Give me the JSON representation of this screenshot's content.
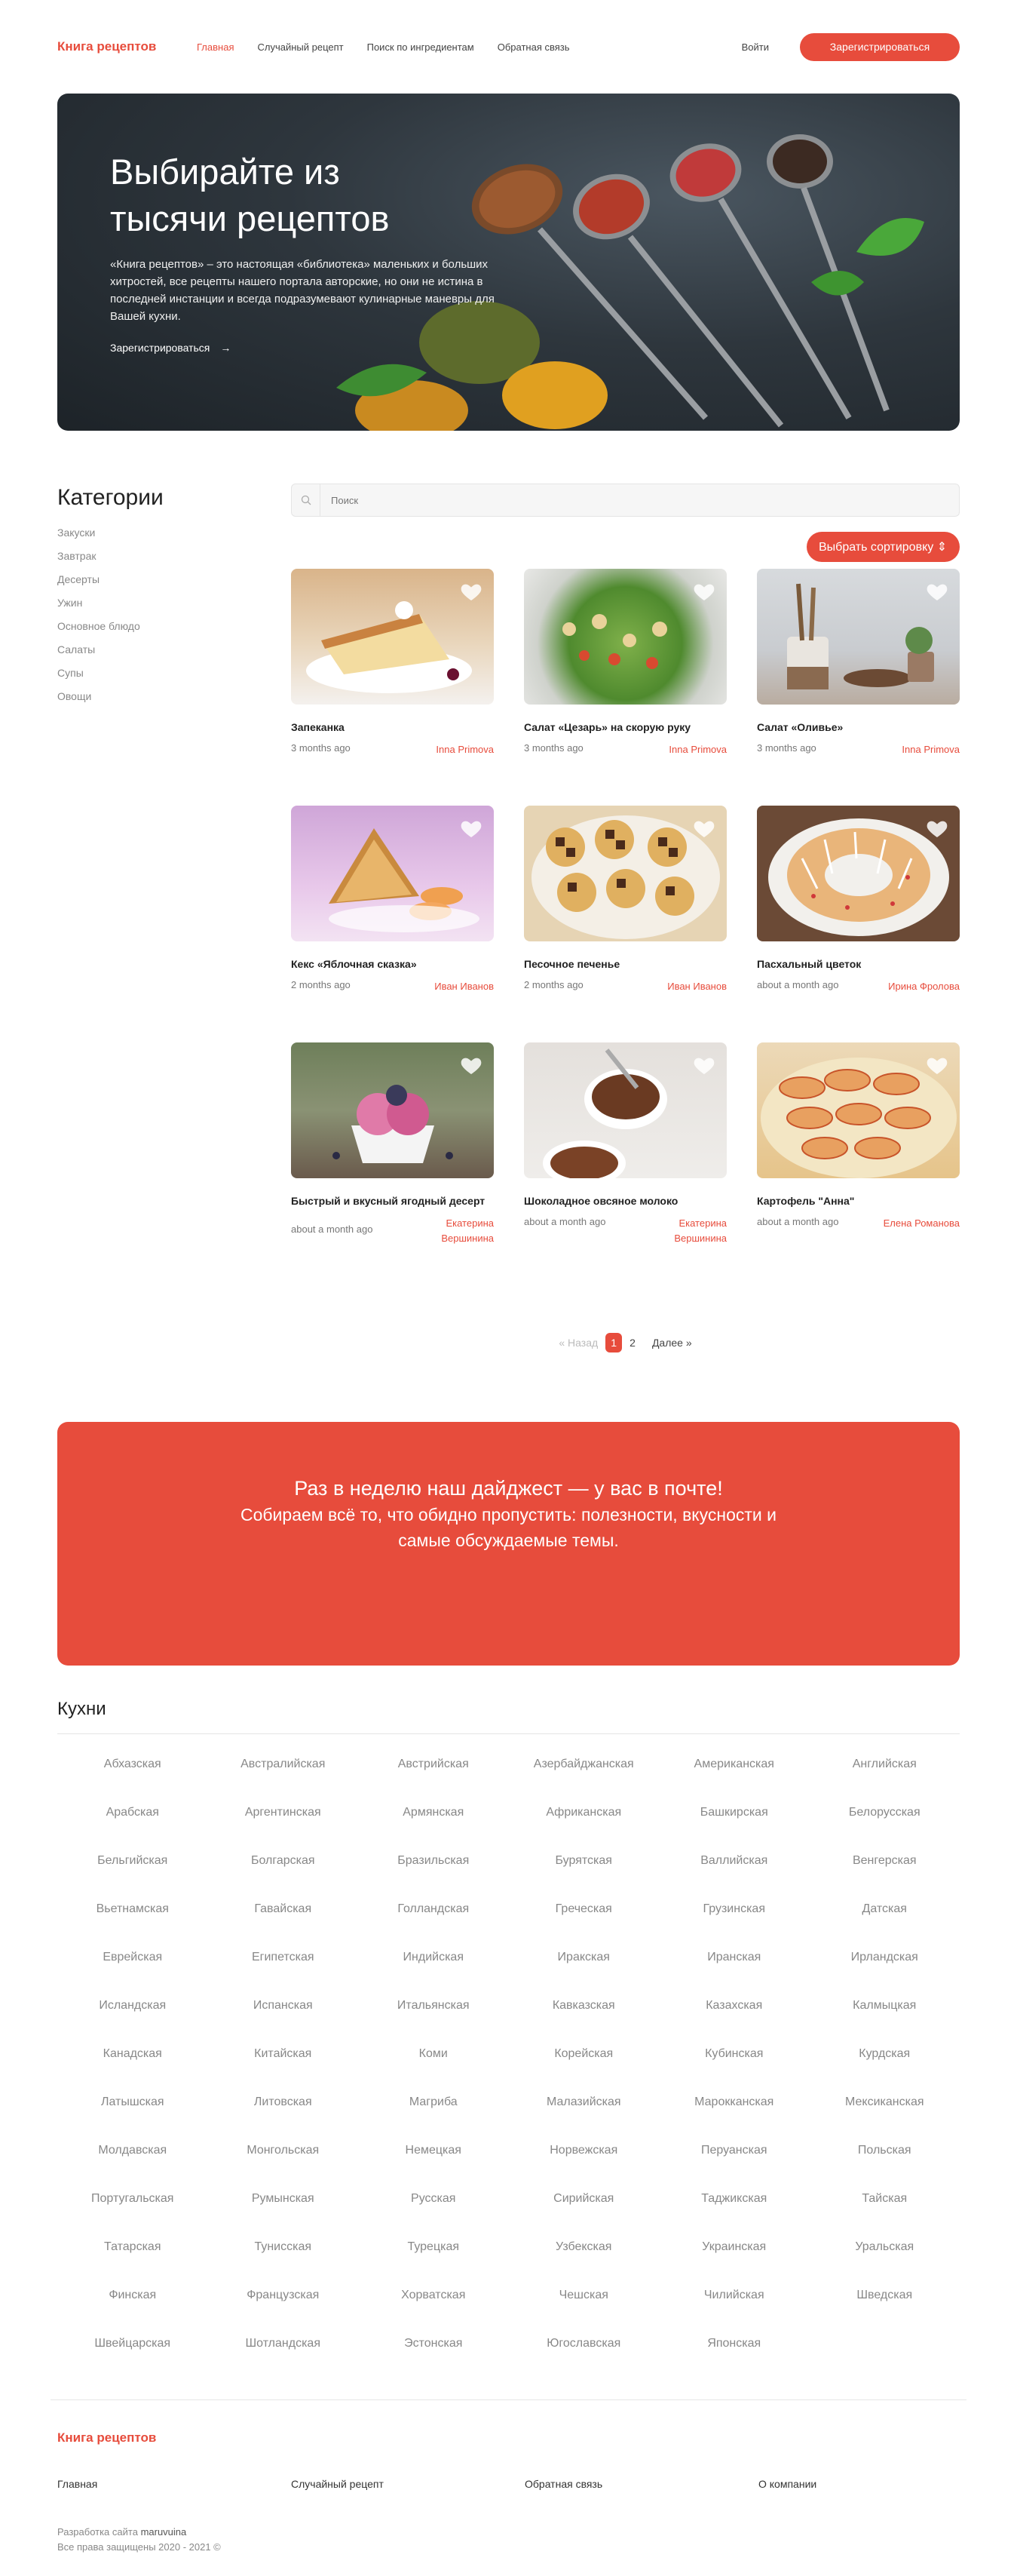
{
  "header": {
    "logo": "Книга рецептов",
    "nav": [
      "Главная",
      "Случайный рецепт",
      "Поиск по ингредиентам",
      "Обратная связь"
    ],
    "login": "Войти",
    "register": "Зарегистрироваться"
  },
  "hero": {
    "title_line1": "Выбирайте из",
    "title_line2": "тысячи рецептов",
    "description": "«Книга рецептов» – это настоящая «библиотека» маленьких и больших хитростей, все рецепты нашего портала авторские, но они не истина в последней инстанции и всегда подразумевают кулинарные маневры для Вашей кухни.",
    "cta": "Зарегистрироваться",
    "cta_arrow": "→"
  },
  "sidebar": {
    "title": "Категории",
    "items": [
      "Закуски",
      "Завтрак",
      "Десерты",
      "Ужин",
      "Основное блюдо",
      "Салаты",
      "Супы",
      "Овощи"
    ]
  },
  "search": {
    "placeholder": "Поиск"
  },
  "sort_button": "Выбрать сортировку ⇕",
  "recipes": [
    {
      "title": "Запеканка",
      "date": "3 months ago",
      "author": "Inna Primova"
    },
    {
      "title": "Салат «Цезарь» на скорую руку",
      "date": "3 months ago",
      "author": "Inna Primova"
    },
    {
      "title": "Салат «Оливье»",
      "date": "3 months ago",
      "author": "Inna Primova"
    },
    {
      "title": "Кекс «Яблочная сказка»",
      "date": "2 months ago",
      "author": "Иван Иванов"
    },
    {
      "title": "Песочное печенье",
      "date": "2 months ago",
      "author": "Иван Иванов"
    },
    {
      "title": "Пасхальный цветок",
      "date": "about a month ago",
      "author": "Ирина Фролова"
    },
    {
      "title": "Быстрый и вкусный ягодный десерт",
      "date": "about a month ago",
      "author": "Екатерина Вершинина"
    },
    {
      "title": "Шоколадное овсяное молоко",
      "date": "about a month ago",
      "author": "Екатерина Вершинина"
    },
    {
      "title": "Картофель \"Анна\"",
      "date": "about a month ago",
      "author": "Елена Романова"
    }
  ],
  "pagination": {
    "prev": "« Назад",
    "pages": [
      "1",
      "2"
    ],
    "next": "Далее »"
  },
  "digest": {
    "headline": "Раз в неделю наш дайджест — у вас в почте!",
    "text": "Собираем всё то, что обидно пропустить: полезности, вкусности и самые обсуждаемые темы."
  },
  "cuisines": {
    "title": "Кухни",
    "items": [
      "Абхазская",
      "Австралийская",
      "Австрийская",
      "Азербайджанская",
      "Американская",
      "Английская",
      "Арабская",
      "Аргентинская",
      "Армянская",
      "Африканская",
      "Башкирская",
      "Белорусская",
      "Бельгийская",
      "Болгарская",
      "Бразильская",
      "Бурятская",
      "Валлийская",
      "Венгерская",
      "Вьетнамская",
      "Гавайская",
      "Голландская",
      "Греческая",
      "Грузинская",
      "Датская",
      "Еврейская",
      "Египетская",
      "Индийская",
      "Иракская",
      "Иранская",
      "Ирландская",
      "Исландская",
      "Испанская",
      "Итальянская",
      "Кавказская",
      "Казахская",
      "Калмыцкая",
      "Канадская",
      "Китайская",
      "Коми",
      "Корейская",
      "Кубинская",
      "Курдская",
      "Латышская",
      "Литовская",
      "Магриба",
      "Малазийская",
      "Марокканская",
      "Мексиканская",
      "Молдавская",
      "Монгольская",
      "Немецкая",
      "Норвежская",
      "Перуанская",
      "Польская",
      "Португальская",
      "Румынская",
      "Русская",
      "Сирийская",
      "Таджикская",
      "Тайская",
      "Татарская",
      "Тунисская",
      "Турецкая",
      "Узбекская",
      "Украинская",
      "Уральская",
      "Финская",
      "Французская",
      "Хорватская",
      "Чешская",
      "Чилийская",
      "Шведская",
      "Швейцарская",
      "Шотландская",
      "Эстонская",
      "Югославская",
      "Японская"
    ]
  },
  "footer": {
    "logo": "Книга рецептов",
    "links": [
      "Главная",
      "Случайный рецепт",
      "Обратная связь",
      "О компании"
    ],
    "dev_label": "Разработка сайта",
    "dev_name": "maruvuina",
    "copyright": "Все права защищены 2020 - 2021 ©"
  },
  "colors": {
    "accent": "#e74c3c"
  },
  "icons": [
    "search-icon",
    "heart-icon",
    "arrow-right-icon"
  ]
}
